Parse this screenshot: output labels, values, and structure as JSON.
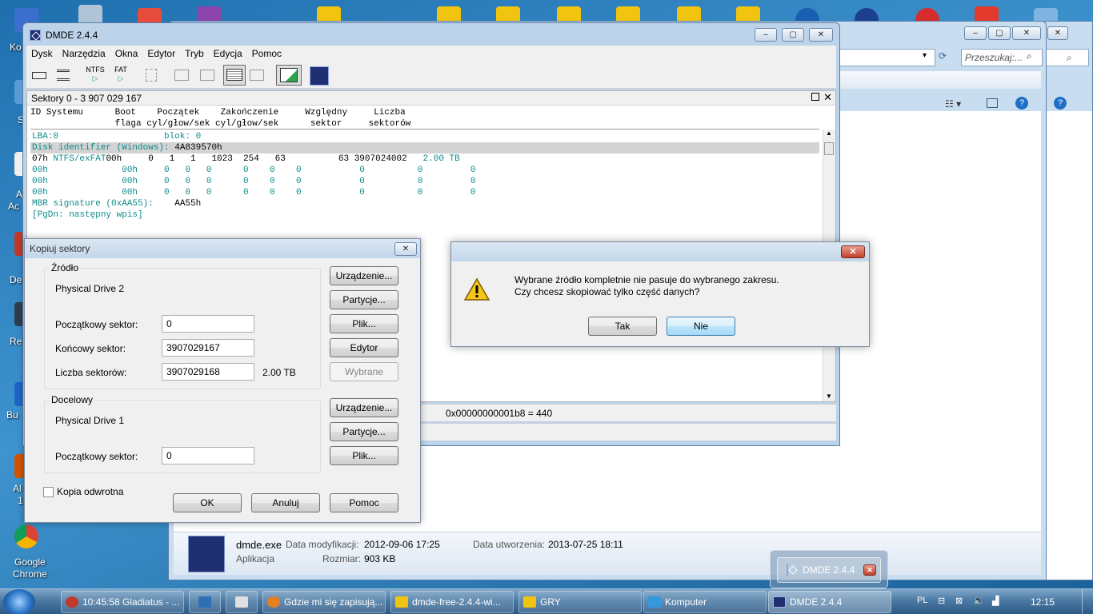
{
  "desktop": {
    "icons": [
      {
        "label": "Ko",
        "color": "#3a6fd0"
      },
      {
        "label": "S",
        "color": "#5b9bd5"
      },
      {
        "label": "A",
        "color": "#f0f0f0"
      },
      {
        "label": "Ac",
        "color": "#c0392b"
      },
      {
        "label": "De",
        "color": "#c0392b"
      },
      {
        "label": "Re",
        "color": "#2c3e50"
      },
      {
        "label": "Bu",
        "color": "#1e64c8"
      },
      {
        "label": "Al",
        "color": "#d35400"
      },
      {
        "label": "1",
        "color": "#d35400"
      }
    ],
    "chrome_label_1": "Google",
    "chrome_label_2": "Chrome"
  },
  "explorer": {
    "search_placeholder": "Przeszukaj:...",
    "file_name": "dmde.exe",
    "file_type": "Aplikacja",
    "modified_label": "Data modyfikacji:",
    "modified_value": "2012-09-06 17:25",
    "created_label": "Data utworzenia:",
    "created_value": "2013-07-25 18:11",
    "size_label": "Rozmiar:",
    "size_value": "903 KB"
  },
  "dmde": {
    "title": "DMDE 2.4.4",
    "menu": [
      "Dysk",
      "Narzędzia",
      "Okna",
      "Edytor",
      "Tryb",
      "Edycja",
      "Pomoc"
    ],
    "toolbar": {
      "ntfs": "NTFS",
      "fat": "FAT"
    },
    "panel_title": "Sektory 0 - 3 907 029 167",
    "columns_line1": "ID Systemu      Boot    Początek    Zakończenie     Względny     Liczba",
    "columns_line2": "                flaga cyl/głow/sek cyl/głow/sek      sektor     sektorów",
    "lba_line": "LBA:0                    blok: 0",
    "disk_id_label": "Disk identifier (Windows):",
    "disk_id_value": "4A839570h",
    "part1_id": "07h",
    "part1_sys": "NTFS/exFAT",
    "part1_rest": "00h     0   1   1   1023  254   63          63 3907024002",
    "part1_size": "2.00 TB",
    "empty_rows": [
      "00h              00h     0   0   0      0    0    0           0          0         0",
      "00h              00h     0   0   0      0    0    0           0          0         0",
      "00h              00h     0   0   0      0    0    0           0          0         0"
    ],
    "mbr_label": "MBR signature (0xAA55):",
    "mbr_value": "AA55h",
    "pgdn": "[PgDn: następny wpis]",
    "status_offset": "0x00000000001b8 = 440"
  },
  "copy_dialog": {
    "title": "Kopiuj sektory",
    "source_group": "Źródło",
    "source_drive": "Physical Drive 2",
    "start_label": "Początkowy sektor:",
    "start_value": "0",
    "end_label": "Końcowy sektor:",
    "end_value": "3907029167",
    "count_label": "Liczba sektorów:",
    "count_value": "3907029168",
    "count_size": "2.00 TB",
    "btn_device": "Urządzenie...",
    "btn_partitions": "Partycje...",
    "btn_file": "Plik...",
    "btn_editor": "Edytor",
    "btn_selected": "Wybrane",
    "target_group": "Docelowy",
    "target_drive": "Physical Drive 1",
    "target_start_label": "Początkowy sektor:",
    "target_start_value": "0",
    "reverse_label": "Kopia odwrotna",
    "btn_ok": "OK",
    "btn_cancel": "Anuluj",
    "btn_help": "Pomoc"
  },
  "message": {
    "line1": "Wybrane źródło kompletnie nie pasuje do wybranego zakresu.",
    "line2": "Czy chcesz skopiować tylko część danych?",
    "yes": "Tak",
    "no": "Nie"
  },
  "preview_title": "DMDE 2.4.4",
  "taskbar": {
    "items": [
      {
        "label": "10:45:58 Gladiatus - ...",
        "color": "#c0392b"
      },
      {
        "label": "",
        "color": "#2e6fb5"
      },
      {
        "label": "",
        "color": "#e0e0e0"
      },
      {
        "label": "Gdzie mi się zapisują...",
        "color": "#e67e22"
      },
      {
        "label": "dmde-free-2.4.4-wi...",
        "color": "#f1c40f"
      },
      {
        "label": "GRY",
        "color": "#f1c40f"
      },
      {
        "label": "Komputer",
        "color": "#3498db"
      },
      {
        "label": "DMDE 2.4.4",
        "color": "#1f2f72"
      }
    ],
    "lang": "PL",
    "clock": "12:15"
  }
}
